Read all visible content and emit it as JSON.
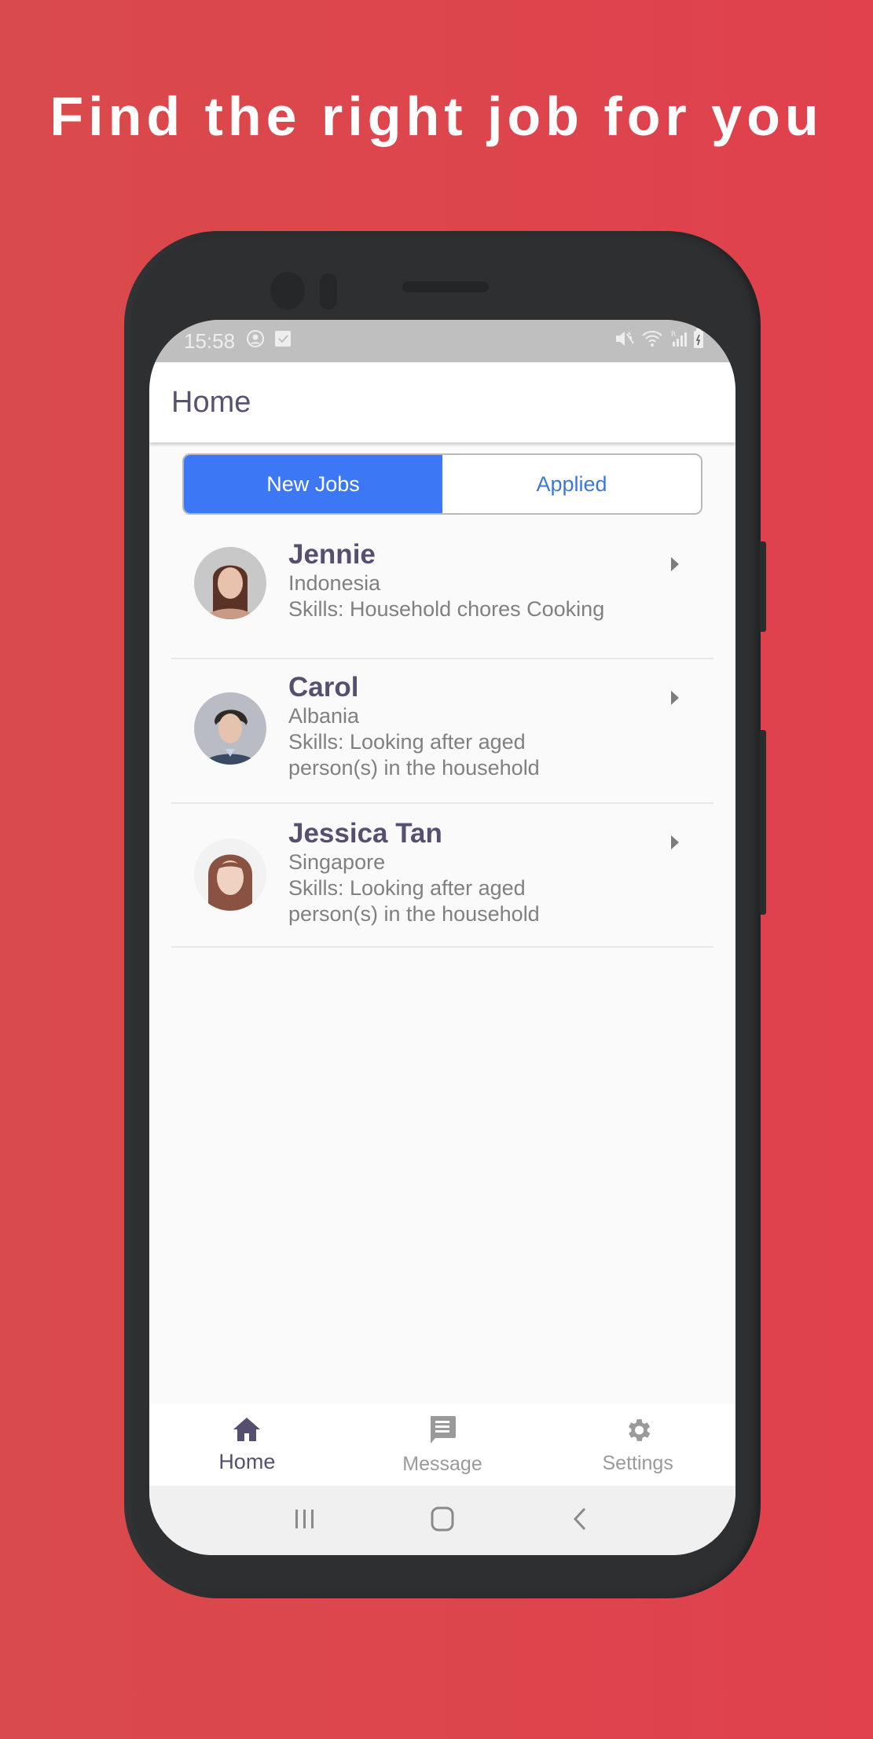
{
  "promo": {
    "headline": "Find the right job for you"
  },
  "colors": {
    "background": "#e0414d",
    "accent": "#3c78f5",
    "title": "#574f6e"
  },
  "status_bar": {
    "time": "15:58",
    "left_icons": [
      "account-circle-icon",
      "checkbox-icon"
    ],
    "right_icons": [
      "mute-vibrate-icon",
      "wifi-icon",
      "signal-roaming-icon",
      "battery-charging-icon"
    ]
  },
  "app_bar": {
    "title": "Home"
  },
  "segment": {
    "tabs": [
      {
        "label": "New Jobs",
        "active": true
      },
      {
        "label": "Applied",
        "active": false
      }
    ]
  },
  "candidates": [
    {
      "name": "Jennie",
      "country": "Indonesia",
      "skills": "Skills: Household chores Cooking",
      "avatar": "woman-portrait"
    },
    {
      "name": "Carol",
      "country": "Albania",
      "skills": "Skills: Looking after aged person(s) in the household",
      "avatar": "man-portrait"
    },
    {
      "name": "Jessica Tan",
      "country": "Singapore",
      "skills": "Skills: Looking after aged person(s) in the household",
      "avatar": "woman-portrait"
    }
  ],
  "bottom_nav": [
    {
      "label": "Home",
      "icon": "home-icon",
      "active": true
    },
    {
      "label": "Message",
      "icon": "message-icon",
      "active": false
    },
    {
      "label": "Settings",
      "icon": "gear-icon",
      "active": false
    }
  ],
  "system_nav": [
    {
      "icon": "recents-icon"
    },
    {
      "icon": "home-circle-icon"
    },
    {
      "icon": "back-icon"
    }
  ]
}
